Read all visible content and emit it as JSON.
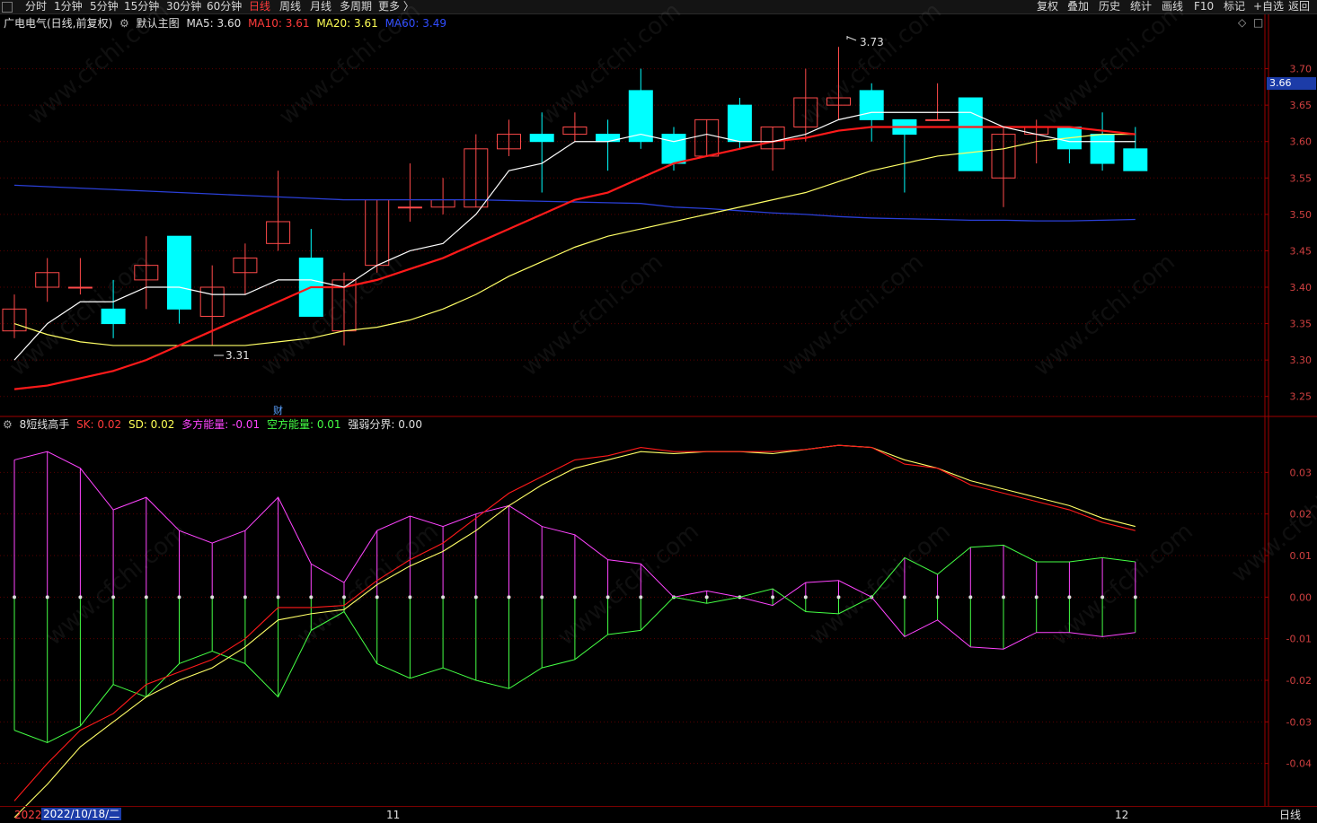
{
  "toolbar": {
    "periods": [
      "分时",
      "1分钟",
      "5分钟",
      "15分钟",
      "30分钟",
      "60分钟",
      "日线",
      "周线",
      "月线",
      "多周期",
      "更多 〉"
    ],
    "active_period": "日线",
    "right_tools": [
      "复权",
      "叠加",
      "历史",
      "统计",
      "画线",
      "F10",
      "标记",
      "+自选",
      "返回"
    ]
  },
  "main_info": {
    "stock": "广电电气(日线,前复权)",
    "template": "默认主图",
    "ma5": "MA5: 3.60",
    "ma10": "MA10: 3.61",
    "ma20": "MA20: 3.61",
    "ma60": "MA60: 3.49",
    "high_label": "3.73",
    "low_label": "3.31",
    "finance_marker": "财",
    "current_price": "3.66"
  },
  "sub_info": {
    "name": "8短线高手",
    "sk": "SK: 0.02",
    "sd": "SD: 0.02",
    "bull": "多方能量: -0.01",
    "bear": "空方能量: 0.01",
    "boundary": "强弱分界: 0.00"
  },
  "bottom": {
    "year": "2022",
    "cursor_date": "2022/10/18/二",
    "month_11": "11",
    "month_12": "12",
    "period_label": "日线"
  },
  "colors": {
    "up": "#ff4a4a",
    "down": "#00ffff",
    "ma5": "#ffffff",
    "ma10": "#ff1a1a",
    "ma20": "#ffff66",
    "ma60": "#2a3fd6",
    "bull": "#ff44ff",
    "bear": "#44ff44"
  },
  "watermark": "www.cfchi.com",
  "chart_data": [
    {
      "type": "candlestick",
      "title": "广电电气(日线,前复权)",
      "y_ticks": [
        "3.70",
        "3.65",
        "3.60",
        "3.55",
        "3.50",
        "3.45",
        "3.40",
        "3.35",
        "3.30",
        "3.25"
      ],
      "ylim": [
        3.225,
        3.75
      ],
      "candles": [
        {
          "o": 3.34,
          "c": 3.37,
          "h": 3.39,
          "l": 3.33
        },
        {
          "o": 3.4,
          "c": 3.42,
          "h": 3.44,
          "l": 3.38
        },
        {
          "o": 3.4,
          "c": 3.4,
          "h": 3.44,
          "l": 3.39
        },
        {
          "o": 3.37,
          "c": 3.35,
          "h": 3.41,
          "l": 3.33
        },
        {
          "o": 3.41,
          "c": 3.43,
          "h": 3.47,
          "l": 3.37
        },
        {
          "o": 3.47,
          "c": 3.37,
          "h": 3.47,
          "l": 3.35
        },
        {
          "o": 3.36,
          "c": 3.4,
          "h": 3.43,
          "l": 3.32
        },
        {
          "o": 3.42,
          "c": 3.44,
          "h": 3.46,
          "l": 3.39
        },
        {
          "o": 3.46,
          "c": 3.49,
          "h": 3.56,
          "l": 3.45
        },
        {
          "o": 3.44,
          "c": 3.36,
          "h": 3.48,
          "l": 3.36
        },
        {
          "o": 3.34,
          "c": 3.41,
          "h": 3.42,
          "l": 3.32
        },
        {
          "o": 3.43,
          "c": 3.52,
          "h": 3.52,
          "l": 3.42
        },
        {
          "o": 3.51,
          "c": 3.51,
          "h": 3.57,
          "l": 3.49
        },
        {
          "o": 3.51,
          "c": 3.52,
          "h": 3.55,
          "l": 3.5
        },
        {
          "o": 3.51,
          "c": 3.59,
          "h": 3.61,
          "l": 3.51
        },
        {
          "o": 3.59,
          "c": 3.61,
          "h": 3.63,
          "l": 3.58
        },
        {
          "o": 3.61,
          "c": 3.6,
          "h": 3.64,
          "l": 3.53
        },
        {
          "o": 3.61,
          "c": 3.62,
          "h": 3.64,
          "l": 3.6
        },
        {
          "o": 3.61,
          "c": 3.6,
          "h": 3.63,
          "l": 3.56
        },
        {
          "o": 3.67,
          "c": 3.6,
          "h": 3.7,
          "l": 3.59
        },
        {
          "o": 3.61,
          "c": 3.57,
          "h": 3.62,
          "l": 3.56
        },
        {
          "o": 3.58,
          "c": 3.63,
          "h": 3.63,
          "l": 3.58
        },
        {
          "o": 3.65,
          "c": 3.6,
          "h": 3.66,
          "l": 3.59
        },
        {
          "o": 3.59,
          "c": 3.62,
          "h": 3.62,
          "l": 3.56
        },
        {
          "o": 3.62,
          "c": 3.66,
          "h": 3.7,
          "l": 3.6
        },
        {
          "o": 3.65,
          "c": 3.66,
          "h": 3.73,
          "l": 3.63
        },
        {
          "o": 3.67,
          "c": 3.63,
          "h": 3.68,
          "l": 3.6
        },
        {
          "o": 3.63,
          "c": 3.61,
          "h": 3.63,
          "l": 3.53
        },
        {
          "o": 3.63,
          "c": 3.63,
          "h": 3.68,
          "l": 3.63
        },
        {
          "o": 3.66,
          "c": 3.56,
          "h": 3.66,
          "l": 3.56
        },
        {
          "o": 3.55,
          "c": 3.61,
          "h": 3.62,
          "l": 3.51
        },
        {
          "o": 3.61,
          "c": 3.62,
          "h": 3.63,
          "l": 3.57
        },
        {
          "o": 3.62,
          "c": 3.59,
          "h": 3.62,
          "l": 3.57
        },
        {
          "o": 3.61,
          "c": 3.57,
          "h": 3.64,
          "l": 3.56
        },
        {
          "o": 3.59,
          "c": 3.56,
          "h": 3.62,
          "l": 3.56
        }
      ],
      "ma5": [
        3.3,
        3.35,
        3.38,
        3.38,
        3.4,
        3.4,
        3.39,
        3.39,
        3.41,
        3.41,
        3.4,
        3.43,
        3.45,
        3.46,
        3.5,
        3.56,
        3.57,
        3.6,
        3.6,
        3.61,
        3.6,
        3.61,
        3.6,
        3.6,
        3.61,
        3.63,
        3.64,
        3.64,
        3.64,
        3.64,
        3.62,
        3.61,
        3.6,
        3.6,
        3.6
      ],
      "ma10": [
        3.26,
        3.265,
        3.275,
        3.285,
        3.3,
        3.32,
        3.34,
        3.36,
        3.38,
        3.4,
        3.4,
        3.41,
        3.425,
        3.44,
        3.46,
        3.48,
        3.5,
        3.52,
        3.53,
        3.55,
        3.57,
        3.58,
        3.59,
        3.6,
        3.605,
        3.615,
        3.62,
        3.62,
        3.62,
        3.62,
        3.62,
        3.62,
        3.62,
        3.615,
        3.61
      ],
      "ma20": [
        3.35,
        3.335,
        3.325,
        3.32,
        3.32,
        3.32,
        3.32,
        3.32,
        3.325,
        3.33,
        3.34,
        3.345,
        3.355,
        3.37,
        3.39,
        3.415,
        3.435,
        3.455,
        3.47,
        3.48,
        3.49,
        3.5,
        3.51,
        3.52,
        3.53,
        3.545,
        3.56,
        3.57,
        3.58,
        3.585,
        3.59,
        3.6,
        3.605,
        3.61,
        3.61
      ],
      "ma60": [
        3.54,
        3.538,
        3.536,
        3.534,
        3.532,
        3.53,
        3.528,
        3.526,
        3.524,
        3.522,
        3.52,
        3.52,
        3.52,
        3.52,
        3.52,
        3.519,
        3.518,
        3.517,
        3.516,
        3.515,
        3.51,
        3.508,
        3.505,
        3.502,
        3.5,
        3.497,
        3.495,
        3.494,
        3.493,
        3.492,
        3.492,
        3.491,
        3.491,
        3.492,
        3.493
      ]
    },
    {
      "type": "line",
      "title": "8短线高手",
      "y_ticks": [
        "0.03",
        "0.02",
        "0.01",
        "0.00",
        "-0.01",
        "-0.02",
        "-0.03",
        "-0.04"
      ],
      "ylim": [
        -0.05,
        0.04
      ],
      "sk": [
        -0.049,
        -0.04,
        -0.032,
        -0.028,
        -0.021,
        -0.018,
        -0.015,
        -0.01,
        -0.0025,
        -0.0025,
        -0.002,
        0.004,
        0.009,
        0.013,
        0.019,
        0.025,
        0.029,
        0.033,
        0.034,
        0.036,
        0.035,
        0.035,
        0.035,
        0.035,
        0.0355,
        0.0365,
        0.036,
        0.032,
        0.031,
        0.027,
        0.025,
        0.023,
        0.021,
        0.018,
        0.016
      ],
      "sd": [
        -0.053,
        -0.045,
        -0.036,
        -0.03,
        -0.024,
        -0.02,
        -0.017,
        -0.012,
        -0.0055,
        -0.004,
        -0.003,
        0.003,
        0.0075,
        0.011,
        0.016,
        0.022,
        0.027,
        0.031,
        0.033,
        0.035,
        0.0345,
        0.035,
        0.035,
        0.0345,
        0.0355,
        0.0365,
        0.036,
        0.033,
        0.031,
        0.028,
        0.026,
        0.024,
        0.022,
        0.019,
        0.017
      ],
      "bull": [
        0.033,
        0.035,
        0.031,
        0.021,
        0.024,
        0.016,
        0.013,
        0.016,
        0.024,
        0.008,
        0.0035,
        0.016,
        0.0195,
        0.017,
        0.02,
        0.022,
        0.017,
        0.015,
        0.009,
        0.008,
        0.0,
        0.0015,
        0.0,
        -0.002,
        0.0035,
        0.004,
        0.0,
        -0.0095,
        -0.0055,
        -0.012,
        -0.0125,
        -0.0085,
        -0.0085,
        -0.0095,
        -0.0085
      ],
      "bear": [
        -0.032,
        -0.035,
        -0.031,
        -0.021,
        -0.024,
        -0.016,
        -0.013,
        -0.016,
        -0.024,
        -0.008,
        -0.0035,
        -0.016,
        -0.0195,
        -0.017,
        -0.02,
        -0.022,
        -0.017,
        -0.015,
        -0.009,
        -0.008,
        0.0,
        -0.0015,
        0.0,
        0.002,
        -0.0035,
        -0.004,
        0.0,
        0.0095,
        0.0055,
        0.012,
        0.0125,
        0.0085,
        0.0085,
        0.0095,
        0.0085
      ]
    }
  ]
}
